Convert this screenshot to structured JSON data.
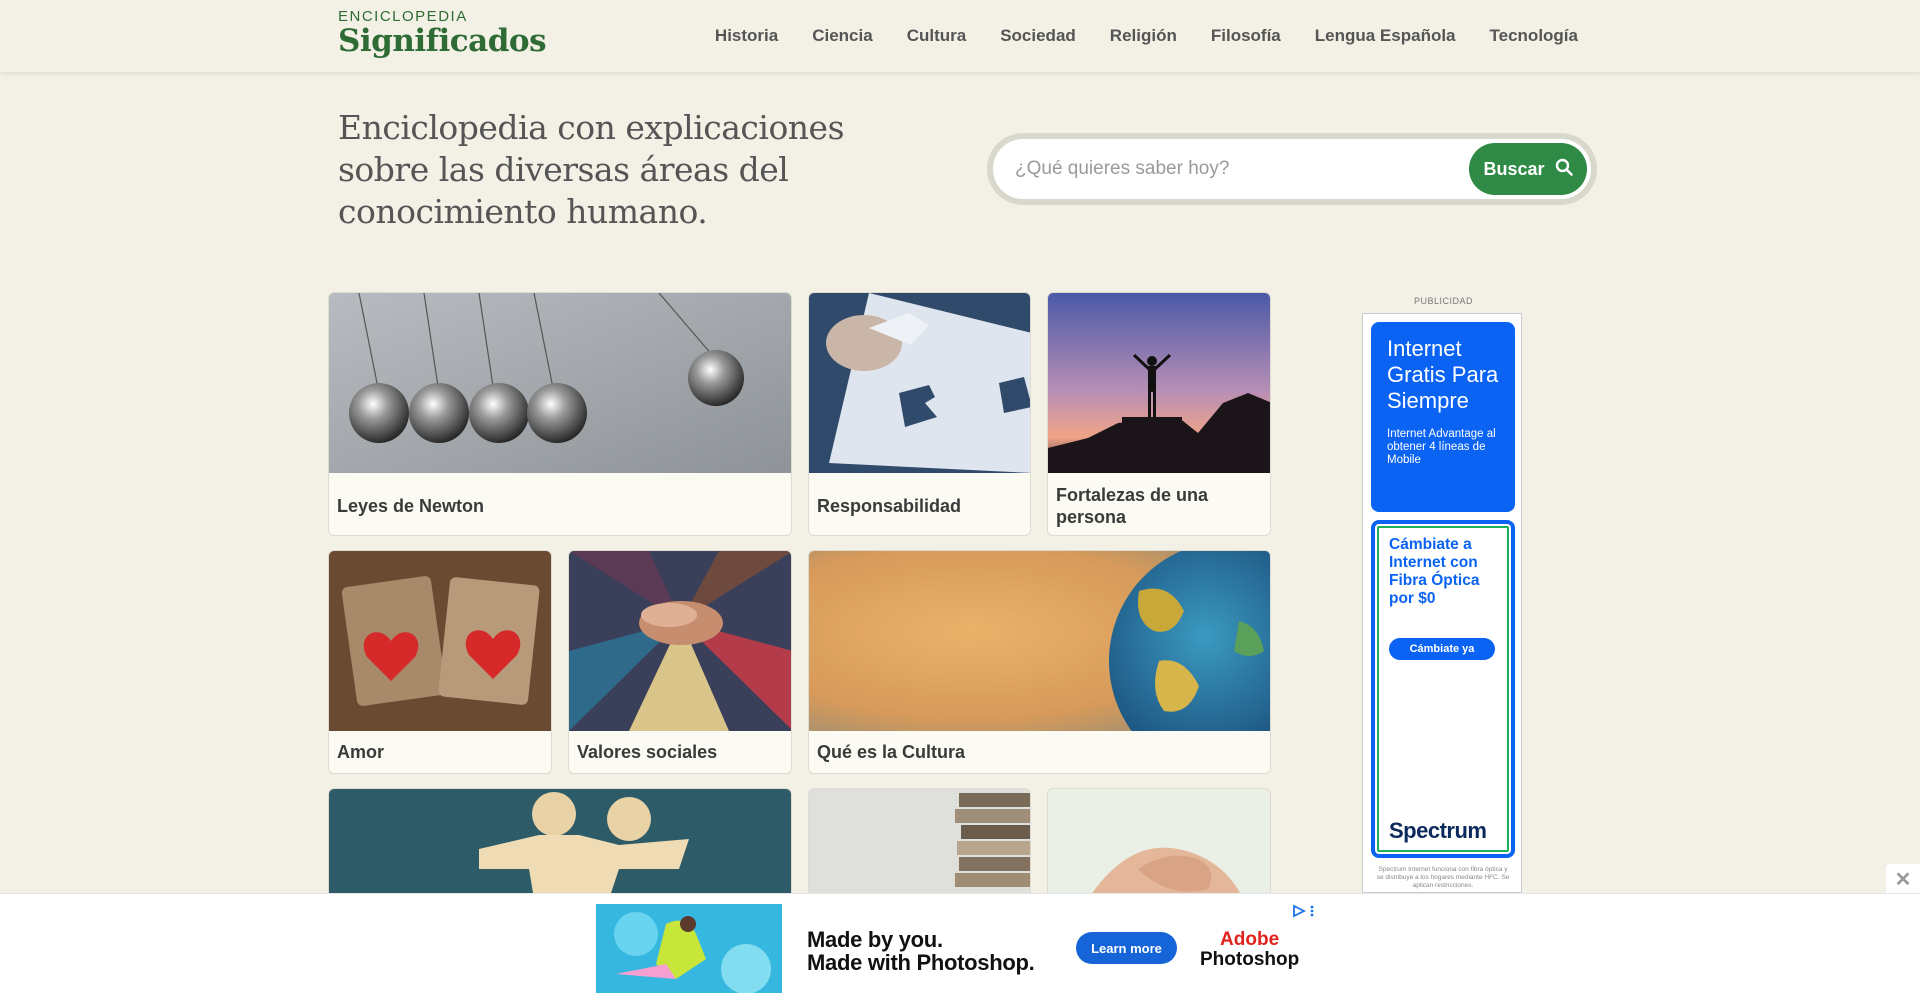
{
  "header": {
    "logo_top": "ENCICLOPEDIA",
    "logo_bottom": "Significados",
    "nav": [
      "Historia",
      "Ciencia",
      "Cultura",
      "Sociedad",
      "Religión",
      "Filosofía",
      "Lengua Española",
      "Tecnología"
    ]
  },
  "hero": {
    "title": "Enciclopedia con explicaciones sobre las diversas áreas del conocimiento humano.",
    "search_placeholder": "¿Qué quieres saber hoy?",
    "search_button": "Buscar"
  },
  "cards": [
    {
      "label": "Leyes de Newton"
    },
    {
      "label": "Responsabilidad"
    },
    {
      "label": "Fortalezas de una persona"
    },
    {
      "label": "Amor"
    },
    {
      "label": "Valores sociales"
    },
    {
      "label": "Qué es la Cultura"
    }
  ],
  "side_ad": {
    "label": "PUBLICIDAD",
    "blue_big": "Internet Gratis Para Siempre",
    "blue_small": "Internet Advantage al obtener 4 líneas de Mobile",
    "white_title": "Cámbiate a Internet con Fibra Óptica por $0",
    "button": "Cámbiate ya",
    "brand": "Spectrum",
    "fine_print": "Spectrum Internet funciona con fibra óptica y se distribuye a los hogares mediante HFC. Se aplican restricciones."
  },
  "bottom_ad": {
    "line1": "Made by you.",
    "line2": "Made with Photoshop.",
    "button": "Learn more",
    "brand_top": "Adobe",
    "brand_bottom": "Photoshop",
    "close": "✕"
  },
  "colors": {
    "background": "#f3f1e6",
    "brand_green": "#2e6b35",
    "button_green": "#2e8a45",
    "spectrum_blue": "#0a63f2",
    "adobe_red": "#e0241d"
  }
}
